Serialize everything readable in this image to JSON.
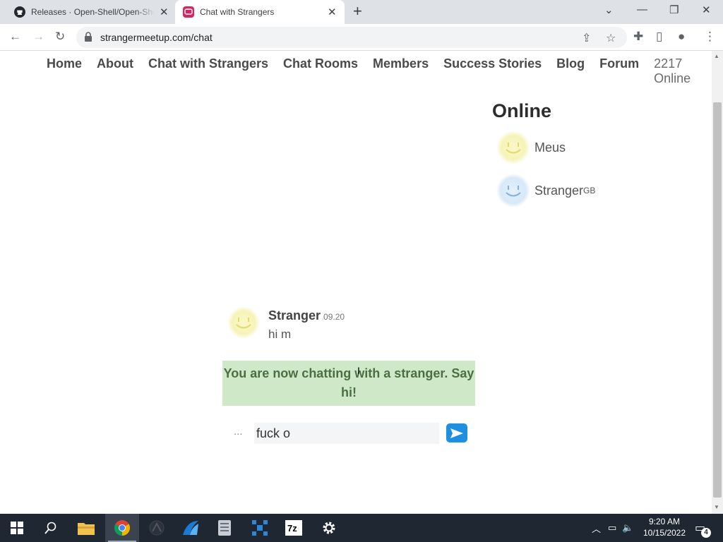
{
  "browser": {
    "tabs": [
      {
        "title": "Releases · Open-Shell/Open-Shell",
        "active": false
      },
      {
        "title": "Chat with Strangers",
        "active": true
      }
    ],
    "url": "strangermeetup.com/chat"
  },
  "nav": {
    "links": [
      "Home",
      "About",
      "Chat with Strangers",
      "Chat Rooms",
      "Members",
      "Success Stories",
      "Blog",
      "Forum"
    ],
    "online_count": "2217 Online"
  },
  "online_panel": {
    "title": "Online",
    "users": [
      {
        "name": "Meus",
        "flag": "",
        "avatar_color": "yellow"
      },
      {
        "name": "Stranger",
        "flag": "GB",
        "avatar_color": "blue"
      }
    ]
  },
  "chat": {
    "messages": [
      {
        "sender": "Stranger",
        "time": "09.20",
        "text": "hi m"
      }
    ],
    "notice": "You are now chatting with a stranger. Say hi!",
    "typing_indicator": "...",
    "input_value": "fuck o"
  },
  "taskbar": {
    "time": "9:20 AM",
    "date": "10/15/2022",
    "notification_count": "4"
  },
  "colors": {
    "notice_bg": "#cfe9c8",
    "notice_text": "#4b6e43",
    "send_button": "#1e8fe1",
    "taskbar_bg": "#1f2732"
  }
}
